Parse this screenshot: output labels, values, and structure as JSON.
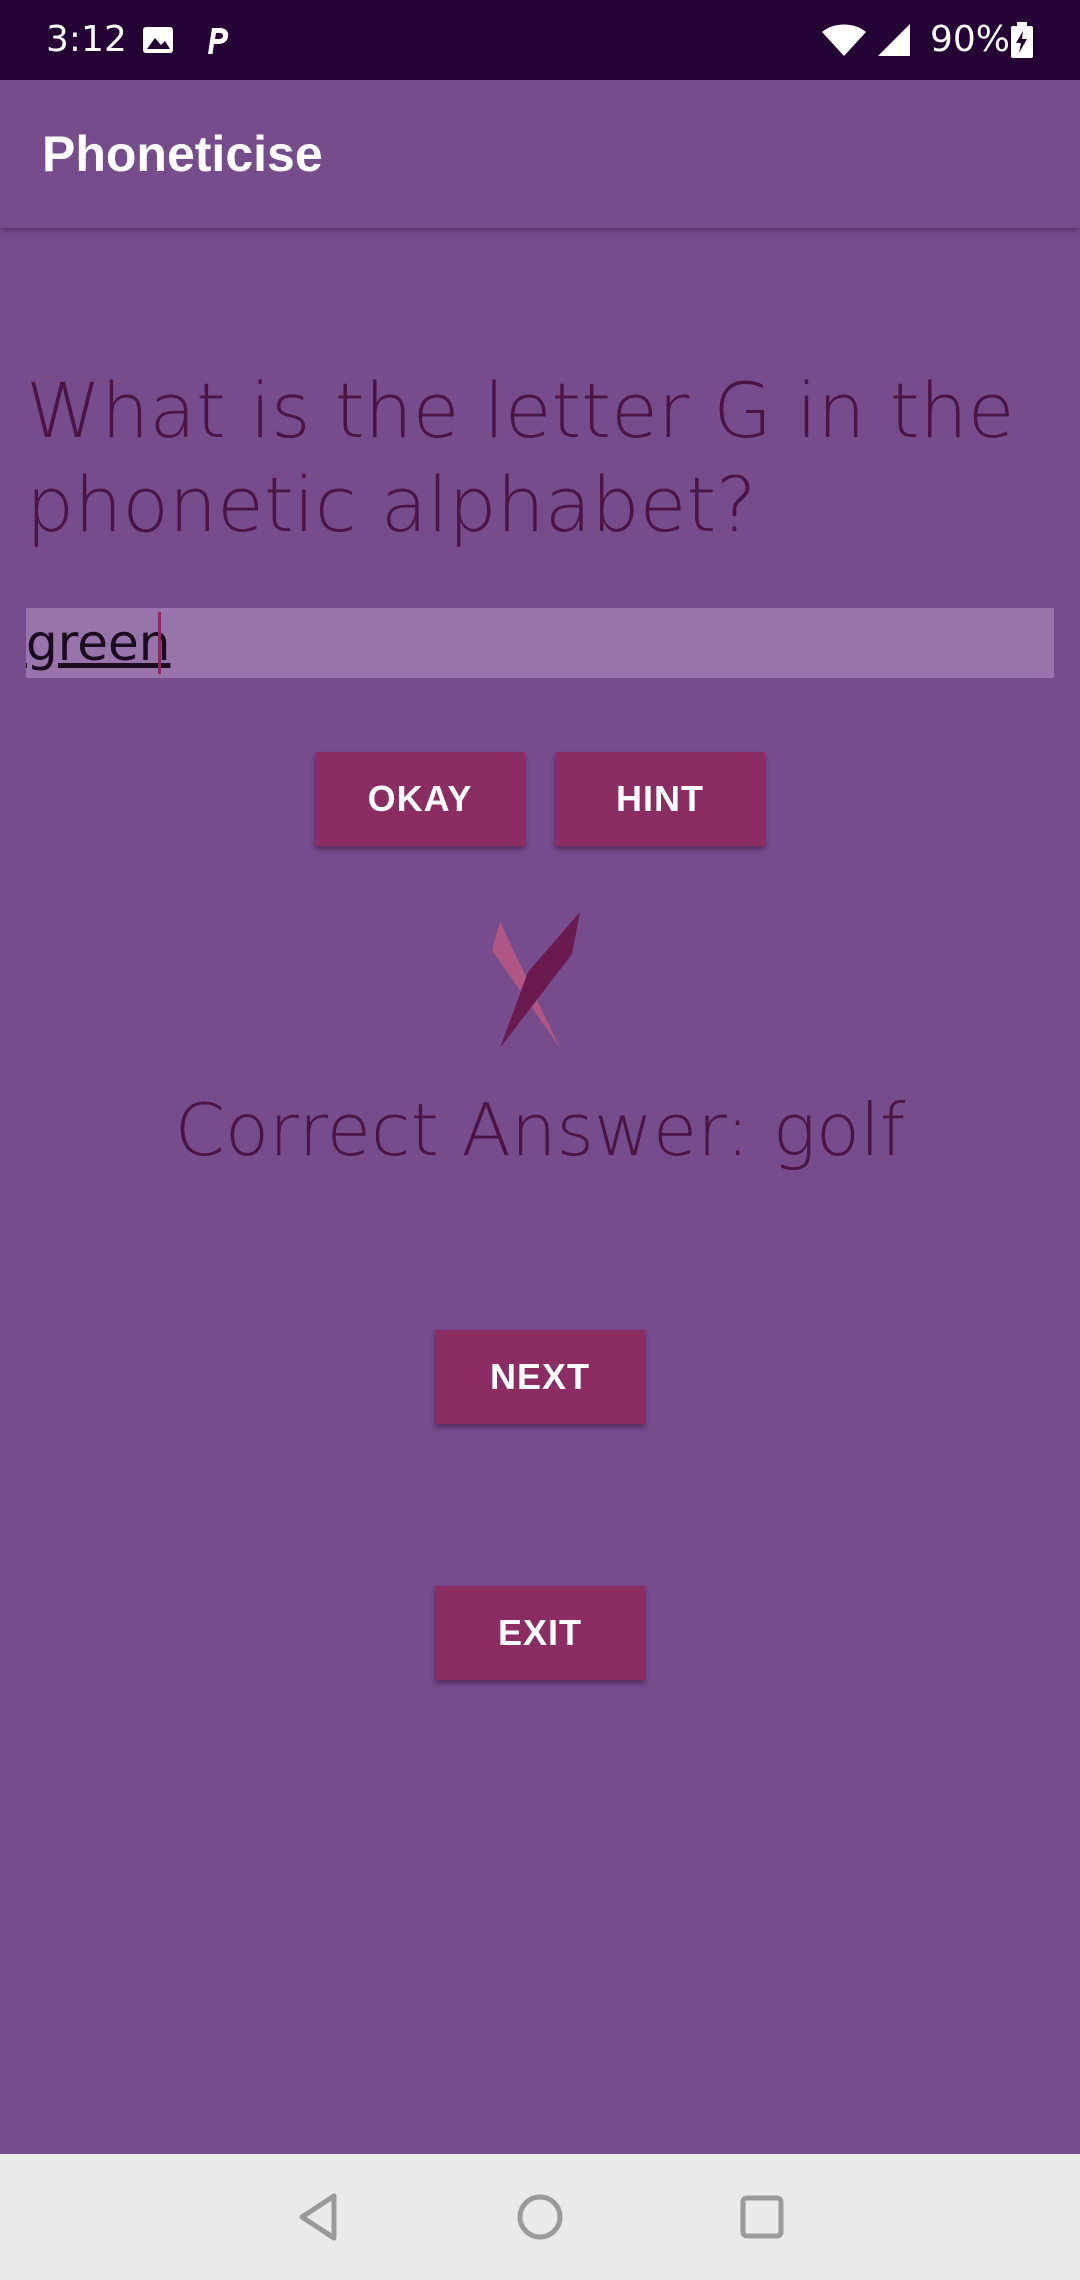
{
  "status_bar": {
    "time": "3:12",
    "battery": "90%",
    "icons": [
      "image-icon",
      "parking-icon",
      "wifi-icon",
      "signal-icon",
      "battery-charging-icon"
    ]
  },
  "app_bar": {
    "title": "Phoneticise"
  },
  "quiz": {
    "question": "What is the letter G in the phonetic alphabet?",
    "answer_value": "green",
    "correct_answer": "Correct Answer: golf",
    "result_icon": "wrong-cross-icon"
  },
  "buttons": {
    "okay": "OKAY",
    "hint": "HINT",
    "next": "NEXT",
    "exit": "EXIT"
  },
  "nav_bar": {
    "icons": [
      "back-icon",
      "home-icon",
      "recents-icon"
    ]
  },
  "colors": {
    "background": "#774c8d",
    "status_bar": "#250035",
    "button": "#8b2c62",
    "text_dark": "#4a1545",
    "input_bg": "#9974ac"
  }
}
